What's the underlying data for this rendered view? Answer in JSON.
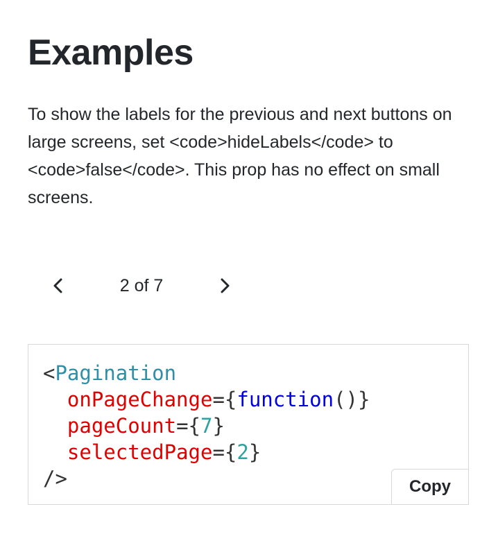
{
  "section": {
    "heading": "Examples",
    "description": "To show the labels for the previous and next buttons on large screens, set <code>hideLabels</code> to <code>false</code>. This prop has no effect on small screens."
  },
  "pagination": {
    "previous_icon": "chevron-left-icon",
    "next_icon": "chevron-right-icon",
    "status": "2 of 7"
  },
  "code_example": {
    "open_bracket": "<",
    "component": "Pagination",
    "props": [
      {
        "name": "onPageChange",
        "equals": "=",
        "open_brace": "{",
        "value": "function",
        "parens": "()",
        "close_brace": "}"
      },
      {
        "name": "pageCount",
        "equals": "=",
        "open_brace": "{",
        "value": "7",
        "close_brace": "}"
      },
      {
        "name": "selectedPage",
        "equals": "=",
        "open_brace": "{",
        "value": "2",
        "close_brace": "}"
      }
    ],
    "close_tag": "/>",
    "copy_label": "Copy"
  },
  "colors": {
    "text": "#23262b",
    "tag": "#2f8fa6",
    "attribute": "#e00000",
    "keyword": "#0000e0",
    "number": "#30a0a0",
    "border": "#d8d8d8"
  }
}
